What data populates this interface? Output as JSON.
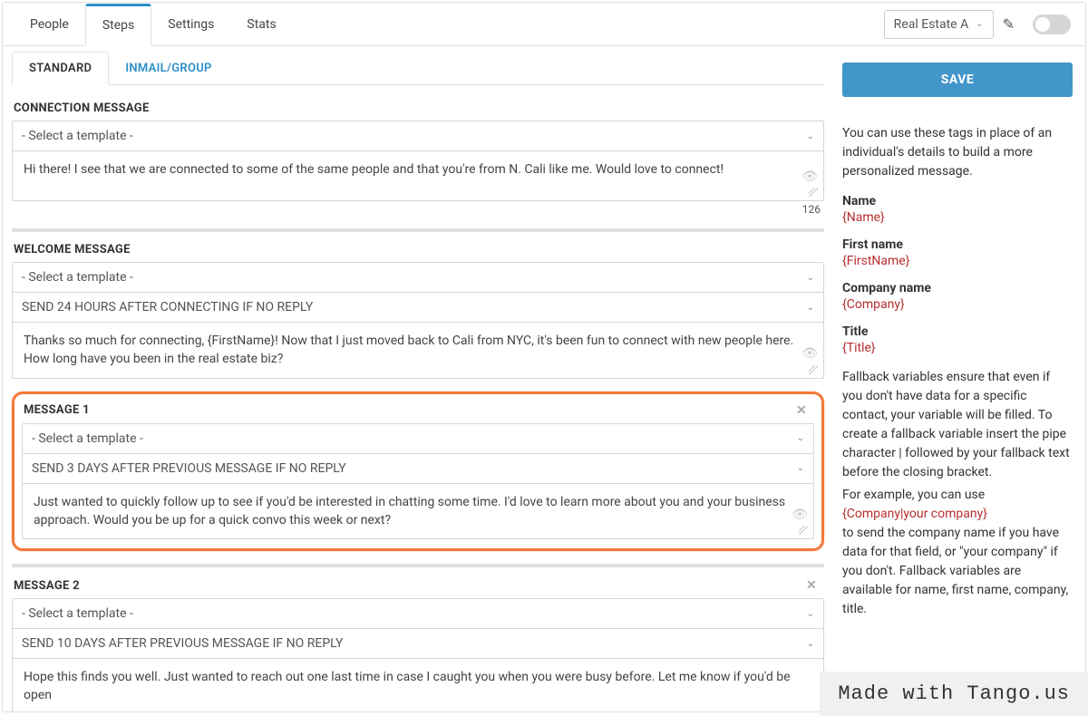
{
  "topTabs": [
    "People",
    "Steps",
    "Settings",
    "Stats"
  ],
  "activeTopTab": 1,
  "campaignName": "Real Estate A",
  "subTabs": [
    "STANDARD",
    "INMAIL/GROUP"
  ],
  "activeSubTab": 0,
  "save": "SAVE",
  "sections": {
    "connection": {
      "title": "CONNECTION MESSAGE",
      "template": "- Select a template -",
      "body": "Hi there! I see that we are connected to some of the same people and that you're from N. Cali like me. Would love to connect!",
      "charCount": "126"
    },
    "welcome": {
      "title": "WELCOME MESSAGE",
      "template": "- Select a template -",
      "timing": "SEND 24 HOURS AFTER CONNECTING IF NO REPLY",
      "body": "Thanks so much for connecting, {FirstName}! Now that I just moved back to Cali from NYC, it's been fun to connect with new people here. How long have you been in the real estate biz?"
    },
    "msg1": {
      "title": "MESSAGE 1",
      "template": "- Select a template -",
      "timing": "SEND 3 DAYS AFTER PREVIOUS MESSAGE IF NO REPLY",
      "body": "Just wanted to quickly follow up to see if you'd be interested in chatting some time. I'd love to learn more about you and your business approach. Would you be up for a quick convo this week or next?"
    },
    "msg2": {
      "title": "MESSAGE 2",
      "template": "- Select a template -",
      "timing": "SEND 10 DAYS AFTER PREVIOUS MESSAGE IF NO REPLY",
      "body": "Hope this finds you well. Just wanted to reach out one last time in case I caught you when you were busy before. Let me know if you'd be open"
    }
  },
  "help": {
    "intro": "You can use these tags in place of an individual's details to build a more personalized message.",
    "items": [
      {
        "label": "Name",
        "tag": "{Name}"
      },
      {
        "label": "First name",
        "tag": "{FirstName}"
      },
      {
        "label": "Company name",
        "tag": "{Company}"
      },
      {
        "label": "Title",
        "tag": "{Title}"
      }
    ],
    "fallback1": "Fallback variables ensure that even if you don't have data for a specific contact, your variable will be filled. To create a fallback variable insert the pipe character | followed by your fallback text before the closing bracket.",
    "fallback2a": "For example, you can use",
    "fallback2tag": "{Company|your company}",
    "fallback2b": "to send the company name if you have data for that field, or \"your company\" if you don't. Fallback variables are available for name, first name, company, title."
  },
  "watermark": "Made with Tango.us"
}
